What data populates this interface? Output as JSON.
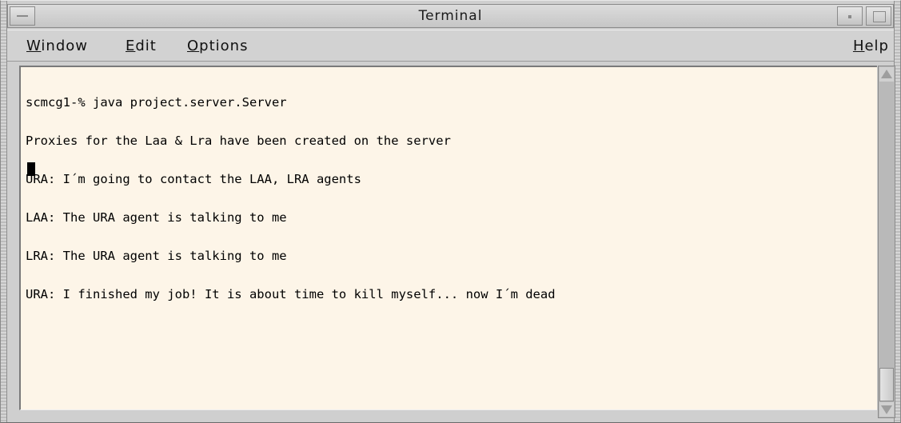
{
  "window": {
    "title": "Terminal"
  },
  "menubar": {
    "items": [
      {
        "label": "Window"
      },
      {
        "label": "Edit"
      },
      {
        "label": "Options"
      }
    ],
    "help_label": "Help"
  },
  "terminal": {
    "lines": [
      "scmcg1-% java project.server.Server",
      "Proxies for the Laa & Lra have been created on the server",
      "URA: I´m going to contact the LAA, LRA agents",
      "LAA: The URA agent is talking to me",
      "LRA: The URA agent is talking to me",
      "URA: I finished my job! It is about time to kill myself... now I´m dead"
    ],
    "background": "#fdf5e8",
    "foreground": "#000000"
  },
  "icons": {
    "window_menu": "window-menu-icon",
    "minimize": "minimize-icon",
    "maximize": "maximize-icon",
    "scroll_up": "arrow-up-icon",
    "scroll_down": "arrow-down-icon"
  }
}
